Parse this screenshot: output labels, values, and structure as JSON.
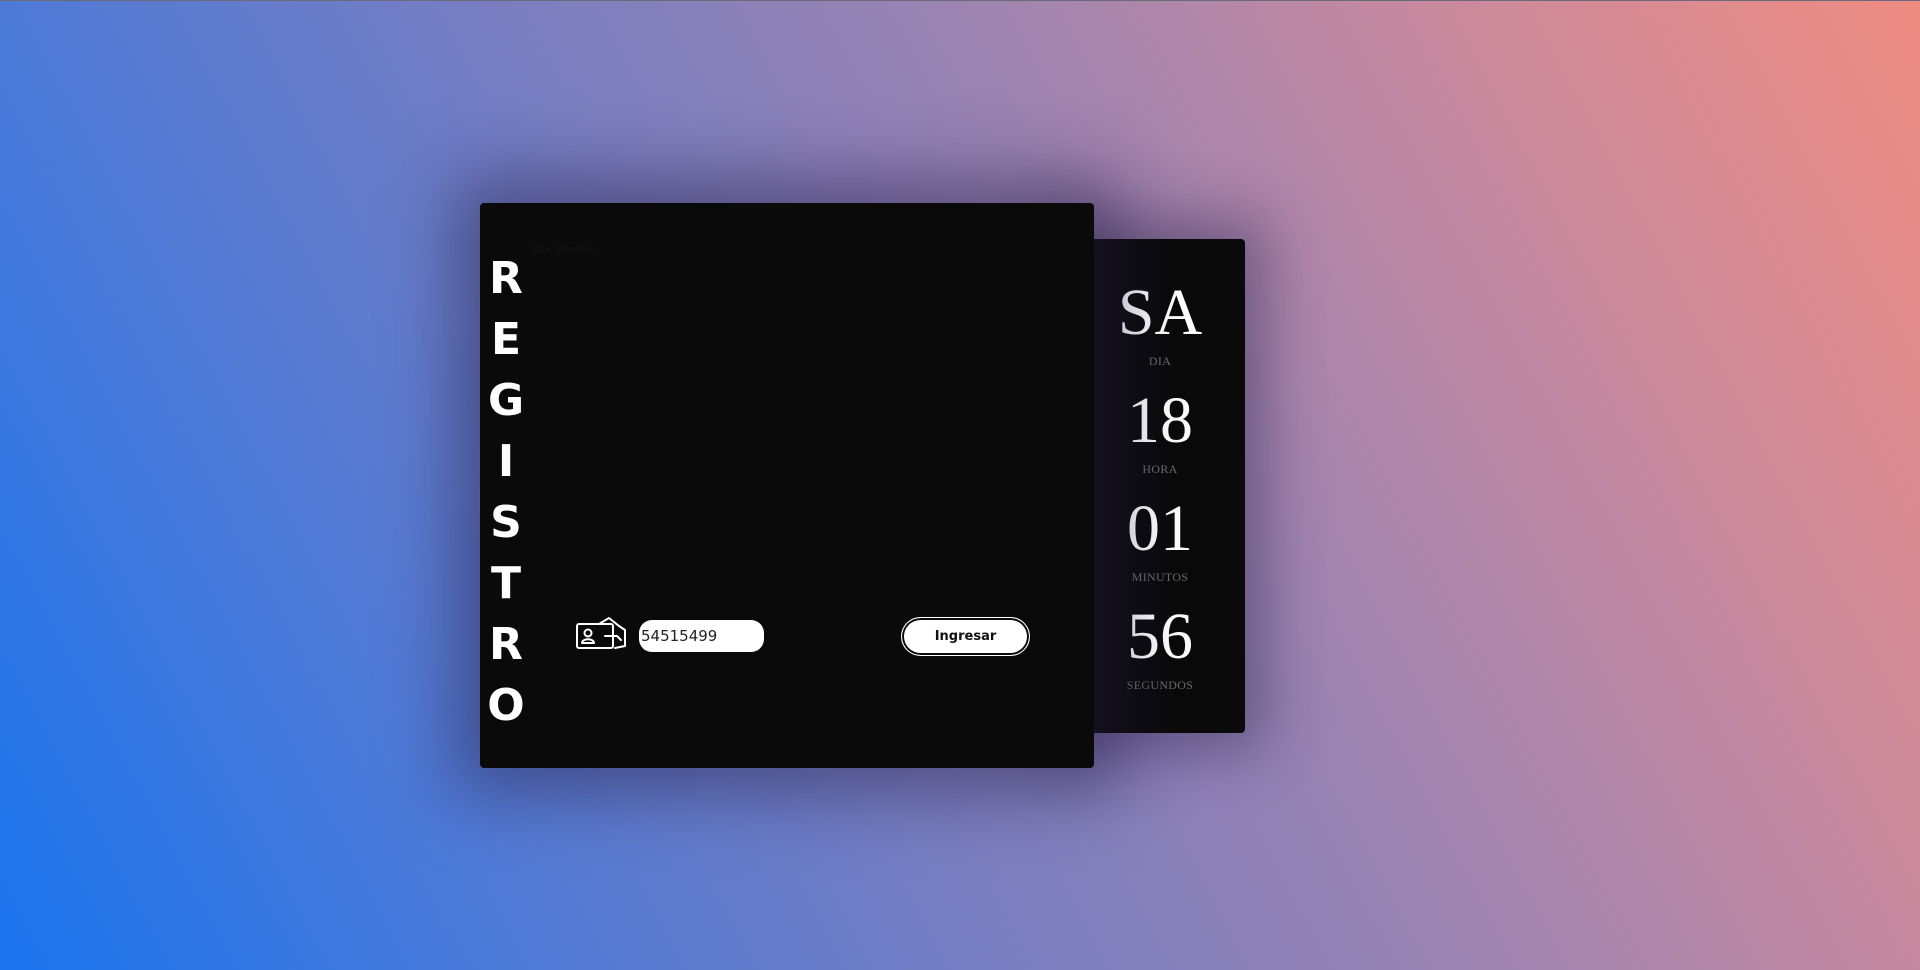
{
  "form": {
    "title_letters": [
      "R",
      "E",
      "G",
      "I",
      "S",
      "T",
      "R",
      "O"
    ],
    "document_label": "Documento",
    "document_value": "54515499",
    "submit_label": "Ingresar",
    "id_icon": "id-card-hand-icon"
  },
  "clock": {
    "day": {
      "value": "SA",
      "label": "DIA"
    },
    "hour": {
      "value": "18",
      "label": "HORA"
    },
    "minutes": {
      "value": "01",
      "label": "MINUTOS"
    },
    "seconds": {
      "value": "56",
      "label": "SEGUNDOS"
    }
  },
  "colors": {
    "card_background": "#0a0a0a",
    "text_primary": "#ffffff",
    "clock_label": "#6d6d6d",
    "gradient_start": "#1a74ee",
    "gradient_end": "#ef8c82"
  }
}
